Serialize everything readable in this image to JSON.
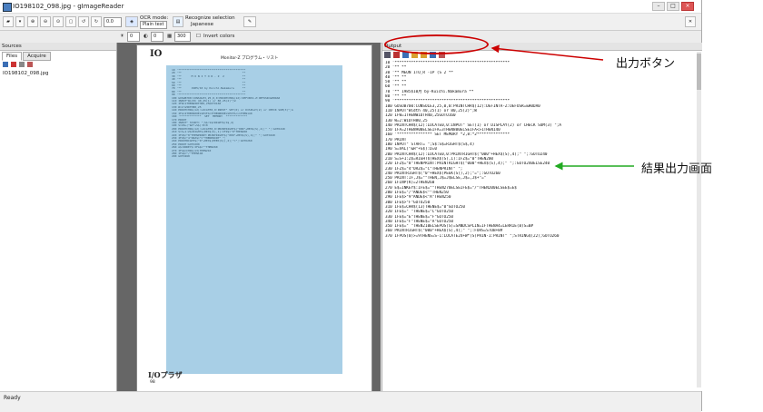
{
  "window": {
    "title": "IO198102_098.jpg - gImageReader"
  },
  "toolbar": {
    "page_value": "0.0",
    "ocr_mode_label": "OCR mode:",
    "ocr_mode_value": "Plain text",
    "recognize_label": "Recognize selection",
    "recognize_lang": "Japanese",
    "brightness": "0",
    "contrast": "0",
    "resolution": "300",
    "invert_label": "Invert colors"
  },
  "sources": {
    "header": "Sources",
    "tabs": [
      "Files",
      "Acquire"
    ],
    "files": [
      "IO198102_098.jpg"
    ]
  },
  "page": {
    "title": "IO",
    "heading": "Monitor-Z プログラム・リスト",
    "footer_logo": "I/Oプラザ",
    "page_number": "98",
    "code_lines": [
      "10 '*****************************************",
      "20 '**                                     **",
      "30 '**      M O N I T O R - Z  2           **",
      "40 '**                                     **",
      "50 '**                                     **",
      "60 '**                                     **",
      "70 '**      1985/10 by Kuichi.Nakamura     **",
      "80 '**                                     **",
      "90 '*****************************************",
      "100 GOSUB700:CONSOLE3,25,0,0:PRINTCHR$(12):DEFINTA-Z:OEFUSR=&H0DA0",
      "110 INPUT\"Width 40,25(1) or 80,25(2)\";W",
      "120 IFW=1THENWIDTH40,25GOTO160",
      "130 W=2:WIDTH80,25",
      "140 PRINTCHR$(12):LOCATE0,0:INPUT\" SET(0) or DISPLAY(2) or CHECK SUM(3)\";A",
      "150 IFA=2THEN900ELSEIFA=3THEN800ELSEIFA<>1THEN140",
      "160 '*************  SET  MEMORY  *************",
      "170 PRINT",
      "180 INPUT\" START= \";S$:S$=RIGHT$(S$,4)",
      "190 S=VAL(\"&H\"+S$):D=0",
      "200 PRINTCHR$(12):LOCATE0,0:PRINTRIGHT$(\"000\"+HEX$(S),4);\" \";:GOTO240",
      "210 S=S+1:Z$=RIGHT$(HEX$(S),1):IFZ$=\"0\"THEN200",
      "220 IFZ$=\"8\"THENPRINT:PRINTRIGHT$(\"000\"+HEX$(S),4);\" \";:GOTO240",
      "230 IFZ$=\"4\"ORZ$=\"C\"THENPRINT\" \";",
      "240 PRINTRIGHT$(\"0\"+HEX$(PEEK(S)),2);\"=\";:GOTO260",
      "250 PRINT:GOTO200",
      "260 A$=INKEY$:IFA$=\"\"THEN260",
      "270 IFA$=CHR$(13)THEN210",
      "280 IFA$=\"/\"THEN140",
      "290 GOTO260"
    ]
  },
  "output": {
    "header": "Output",
    "lines": [
      "10 '*************************************************",
      "20 '**                                             **",
      "30 '**    MEON 1TO_R -1P (S 2          **",
      "40 '**                                             **",
      "50 '**                                             **",
      "60 '**                                             **",
      "70 '**      1985$10月 by-Kuichi.Nakamura    **",
      "80 '**                                             **",
      "90 '*************************************************",
      "100 GOSUB700:CONSOLE3,25,0,0:PRINTCHR$(12):DEFINTA-Z:OEFUSR=&H0DA0",
      "110 INPUT\"Width 40,25(1) or 80,25(2)\";W",
      "120 IFW=1THENWIDTH40,25GOTO160",
      "130 W=2:WIDTH80,25",
      "140 PRINTCHR$(12):LOCATE0,0:INPUT\" SET(1) or DISPLAY(2) or CHECK SUM(3) \";A",
      "150 IFA=2THEN900ELSEIFA=3THEN800ELSEIFA<>1THEN140",
      "160 '*************** SET  MEMORY *2,8:*2**************",
      "170 PRINT",
      "180 INPUT\" START= \";S$:S$=RIGHT$(S$,4)",
      "190 S=VAL(\"&H\"+S$):D=0",
      "200 PRINTCHR$(12):LOCATE0,0:PRINTRIGHT$(\"000\"+HEX$(S),4);\" \";:GOTO240",
      "210 S=S+1:Z$=RIGHT$(HEX$(S),1):IFZ$=\"0\"THEN200",
      "220 IFZ$=\"8\"THENPRINT:PRINTRIGHT$(\"000\"+HEX$(S),4);\" \";:GOTO240ELSE240",
      "230 IFZ$=\"4\"ORZ$=\"C\"THENPRINT\" \";",
      "240 PRINTRIGHT$(\"0\"+HEX$(PEEK(S)),2);\"=\";:GOTO260",
      "250 PRINT:IF,J$=\"\"THEN,J$=J$ELSE,J$=,J$+\"=\"",
      "260 IFINP(K)=2THEN260",
      "270 E$=INKEY$:IFE$=\"\"THEN270ELSEIFE$=\"/\"THEN200ELSEE$=E$",
      "280 IFE$=\"/\"ANDE$<\"\"THEN250",
      "290 IFE$>\"9\"ANDE$<\"A\"THEN250",
      "300 IFE$>\"F\"GOTO250",
      "310 IFE$=CHR$(13)THENE$=\"0\"GOTO250",
      "320 IFE$=\" \"THENE$=\"C\"GOTO250",
      "330 IFE$=\"E\"THENE$=\"F\"GOTO250",
      "340 IFE$=\"F\"THENE$=\"A\"GOTO250",
      "350 IFE$=\" \"THEN210ELSEPOS(S)=SANDCSPLIN=IFTHENA4=LERRIE(B)S=B#",
      "360 PRINTRIGHT$(\"000\"+HEX$(S),4);\" \";:FORS=STOB+8#",
      "370 IFPOS(0)>=9THENS=S-1:LOCATE24+W*(S)PRIN-1:PRINT\" \";STRING$(22);GOTO260"
    ]
  },
  "status": {
    "text": "Ready"
  },
  "annotations": {
    "output_button": "出力ボタン",
    "result_screen": "結果出力画面"
  },
  "colors": {
    "highlight_ellipse": "#cc0000",
    "arrow_output_button": "#cc0000",
    "arrow_result": "#22aa22",
    "page_highlight": "#a8cfe6"
  }
}
